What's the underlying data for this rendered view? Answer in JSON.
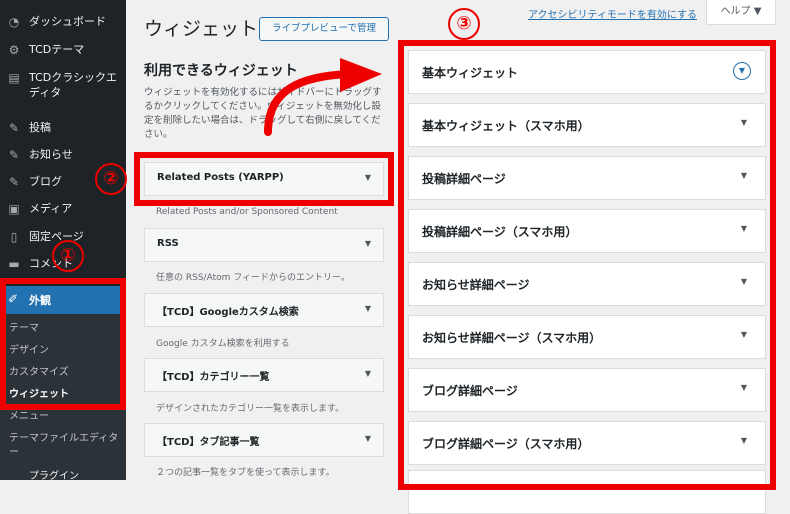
{
  "sidebar": {
    "items": [
      {
        "label": "ダッシュボード",
        "icon": "dashboard-icon"
      },
      {
        "label": "TCDテーマ",
        "icon": "gear-icon"
      },
      {
        "label": "TCDクラシックエディタ",
        "icon": "editor-icon"
      },
      {
        "label": "投稿",
        "icon": "pin-icon"
      },
      {
        "label": "お知らせ",
        "icon": "pin-icon"
      },
      {
        "label": "ブログ",
        "icon": "pin-icon"
      },
      {
        "label": "メディア",
        "icon": "media-icon"
      },
      {
        "label": "固定ページ",
        "icon": "page-icon"
      },
      {
        "label": "コメント",
        "icon": "comment-icon"
      }
    ],
    "appearance": {
      "label": "外観",
      "icon": "brush-icon"
    },
    "submenu": [
      {
        "label": "テーマ"
      },
      {
        "label": "デザイン"
      },
      {
        "label": "カスタマイズ"
      },
      {
        "label": "ウィジェット",
        "current": true
      },
      {
        "label": "メニュー"
      },
      {
        "label": "テーマファイルエディター"
      }
    ],
    "plugins_label": "プラグイン"
  },
  "header": {
    "title": "ウィジェット",
    "live_preview_button": "ライブプレビューで管理",
    "accessibility_link": "アクセシビリティモードを有効にする",
    "help_button": "ヘルプ ▼"
  },
  "available": {
    "title": "利用できるウィジェット",
    "description": "ウィジェットを有効化するにはサイドバーにドラッグするかクリックしてください。ウィジェットを無効化し設定を削除したい場合は、ドラッグして右側に戻してください。",
    "widgets": [
      {
        "title": "Related Posts (YARPP)",
        "description": "Related Posts and/or Sponsored Content"
      },
      {
        "title": "RSS",
        "description": "任意の RSS/Atom フィードからのエントリー。"
      },
      {
        "title": "【TCD】Googleカスタム検索",
        "description": "Google カスタム検索を利用する"
      },
      {
        "title": "【TCD】カテゴリー一覧",
        "description": "デザインされたカテゴリー一覧を表示します。"
      },
      {
        "title": "【TCD】タブ記事一覧",
        "description": "２つの記事一覧をタブを使って表示します。"
      }
    ]
  },
  "areas": [
    {
      "title": "基本ウィジェット",
      "expanded": true
    },
    {
      "title": "基本ウィジェット（スマホ用）"
    },
    {
      "title": "投稿詳細ページ"
    },
    {
      "title": "投稿詳細ページ（スマホ用）"
    },
    {
      "title": "お知らせ詳細ページ"
    },
    {
      "title": "お知らせ詳細ページ（スマホ用）"
    },
    {
      "title": "ブログ詳細ページ"
    },
    {
      "title": "ブログ詳細ページ（スマホ用）"
    }
  ],
  "annotations": {
    "badge1": "①",
    "badge2": "②",
    "badge3": "③",
    "color": "#ee0000"
  },
  "colors": {
    "sidebar_bg": "#1d2327",
    "accent": "#2271b1",
    "annotation": "#ee0000"
  }
}
